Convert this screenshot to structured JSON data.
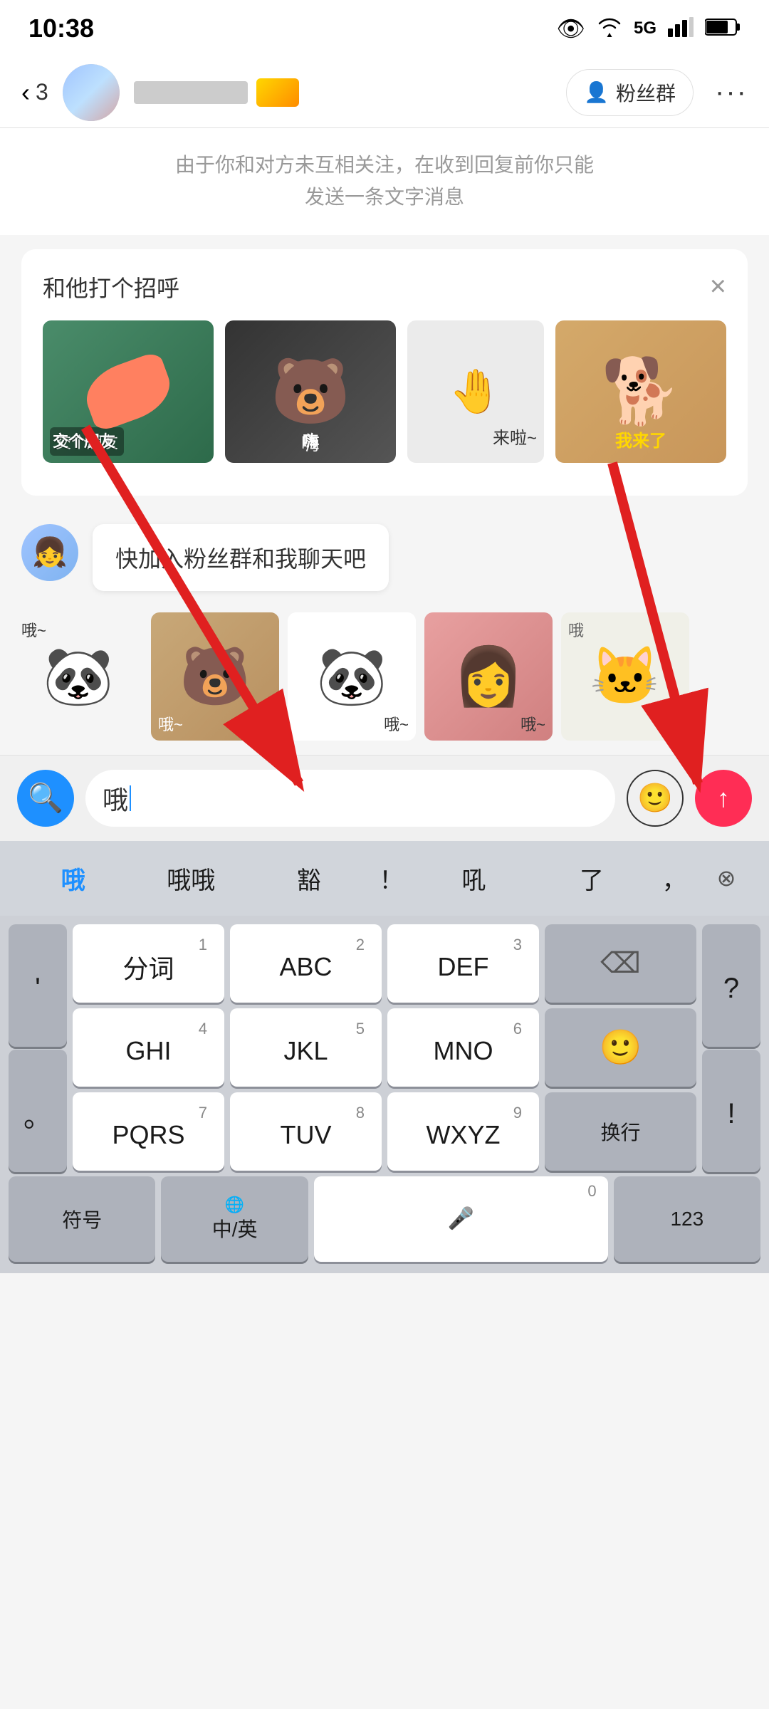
{
  "status_bar": {
    "time": "10:38",
    "icons": [
      "👁",
      "📶",
      "🔋"
    ]
  },
  "nav": {
    "back_count": "3",
    "user_name": "██████",
    "fans_group": "粉丝群",
    "more": "···"
  },
  "notice": {
    "text": "由于你和对方未互相关注，在收到回复前你只能\n发送一条文字消息"
  },
  "sticker_panel": {
    "title": "和他打个招呼",
    "close": "×",
    "stickers_top": [
      {
        "label": "交个朋友",
        "emoji": ""
      },
      {
        "label": "嗨",
        "emoji": "🐻"
      },
      {
        "label": "来啦~",
        "emoji": ""
      },
      {
        "label": "我来了",
        "emoji": "🐕"
      }
    ],
    "stickers_bottom": [
      {
        "label": "哦~",
        "emoji": "🐼"
      },
      {
        "label": "哦~",
        "emoji": "🐻"
      },
      {
        "label": "哦~",
        "emoji": "🐼"
      },
      {
        "label": "哦~",
        "emoji": "👩"
      },
      {
        "label": "哦",
        "emoji": "🐱"
      }
    ]
  },
  "chat": {
    "bubble_text": "快加入粉丝群和我聊天吧"
  },
  "input_area": {
    "search_placeholder": "",
    "input_text": "哦",
    "emoji_label": "😊",
    "send_label": "↑"
  },
  "ime": {
    "suggestions": [
      "哦",
      "哦哦",
      "豁",
      "！",
      "吼",
      "了",
      "，"
    ],
    "delete": "⊗"
  },
  "keyboard": {
    "row1": [
      {
        "label": "分词",
        "number": "1"
      },
      {
        "label": "ABC",
        "number": "2"
      },
      {
        "label": "DEF",
        "number": "3"
      }
    ],
    "row2": [
      {
        "label": "GHI",
        "number": "4"
      },
      {
        "label": "JKL",
        "number": "5"
      },
      {
        "label": "MNO",
        "number": "6"
      }
    ],
    "row3": [
      {
        "label": "PQRS",
        "number": "7"
      },
      {
        "label": "TUV",
        "number": "8"
      },
      {
        "label": "WXYZ",
        "number": "9"
      }
    ],
    "punct_col": [
      "'",
      "。",
      "?",
      "!"
    ],
    "bottom": {
      "fuhao": "符号",
      "zhong": "中/英",
      "earth": "🌐",
      "zero": "0",
      "mic": "🎤",
      "num": "123",
      "newline": "换行"
    }
  }
}
